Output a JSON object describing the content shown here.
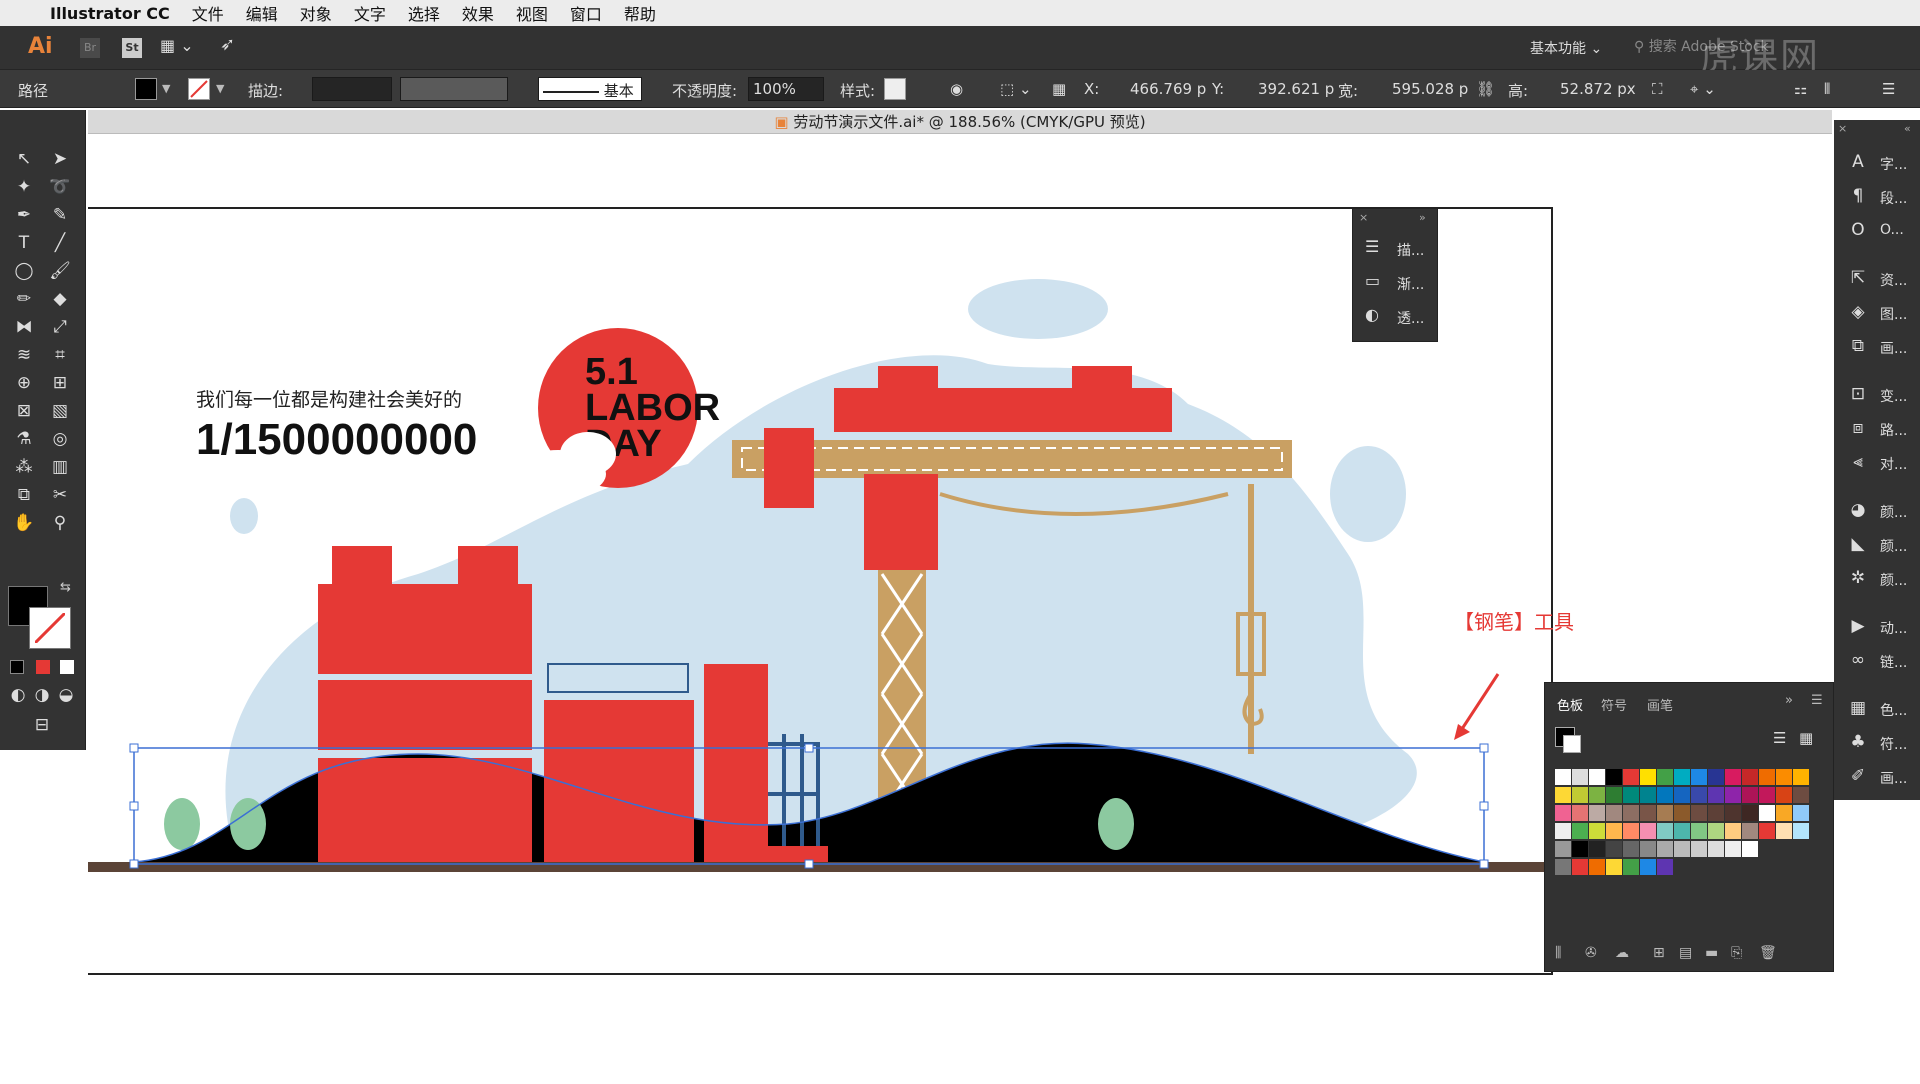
{
  "menubar": {
    "app": "Illustrator CC",
    "items": [
      "文件",
      "编辑",
      "对象",
      "文字",
      "选择",
      "效果",
      "视图",
      "窗口",
      "帮助"
    ]
  },
  "appbar": {
    "logo": "Ai",
    "bridge": "Br",
    "stock": "St",
    "workspace": "基本功能",
    "search_placeholder": "搜索 Adobe Stock",
    "watermark": "虎课网"
  },
  "control": {
    "object_type": "路径",
    "stroke_label": "描边:",
    "brush_label": "基本",
    "opacity_label": "不透明度:",
    "opacity_value": "100%",
    "style_label": "样式:",
    "x_label": "X:",
    "x_value": "466.769 p",
    "y_label": "Y:",
    "y_value": "392.621 p",
    "w_label": "宽:",
    "w_value": "595.028 p",
    "h_label": "高:",
    "h_value": "52.872 px"
  },
  "document": {
    "tab_title": "劳动节演示文件.ai* @ 188.56% (CMYK/GPU 预览)"
  },
  "artwork": {
    "subtitle": "我们每一位都是构建社会美好的",
    "headline": "1/1500000000",
    "badge_line1": "5.1",
    "badge_line2": "LABOR",
    "badge_line3": "DAY"
  },
  "annotation": {
    "text": "【钢笔】工具"
  },
  "mini_panel": {
    "items": [
      {
        "icon": "stroke-icon",
        "label": "描..."
      },
      {
        "icon": "gradient-icon",
        "label": "渐..."
      },
      {
        "icon": "transparency-icon",
        "label": "透..."
      }
    ]
  },
  "right_dock": {
    "items": [
      {
        "icon": "character-icon",
        "label": "字..."
      },
      {
        "icon": "paragraph-icon",
        "label": "段..."
      },
      {
        "icon": "opentype-icon",
        "label": "O..."
      },
      {
        "icon": "export-icon",
        "label": "资..."
      },
      {
        "icon": "layers-icon",
        "label": "图..."
      },
      {
        "icon": "artboards-icon",
        "label": "画..."
      },
      {
        "icon": "transform-icon",
        "label": "变..."
      },
      {
        "icon": "pathfinder-icon",
        "label": "路..."
      },
      {
        "icon": "align-icon",
        "label": "对..."
      },
      {
        "icon": "color-icon",
        "label": "颜..."
      },
      {
        "icon": "color-guide-icon",
        "label": "颜..."
      },
      {
        "icon": "color-theme-icon",
        "label": "颜..."
      },
      {
        "icon": "actions-icon",
        "label": "动..."
      },
      {
        "icon": "links-icon",
        "label": "链..."
      },
      {
        "icon": "swatches-icon",
        "label": "色..."
      },
      {
        "icon": "symbols-icon",
        "label": "符..."
      },
      {
        "icon": "brushes-icon",
        "label": "画..."
      }
    ]
  },
  "swatches_panel": {
    "tabs": [
      "色板",
      "符号",
      "画笔"
    ]
  },
  "colors": {
    "accent_red": "#e53935",
    "crane_gold": "#c9a063",
    "sky_blue": "#cfe2ef",
    "ground": "#5b4437",
    "steel_blue": "#2f5a8c",
    "tree_green": "#8cc9a0"
  }
}
